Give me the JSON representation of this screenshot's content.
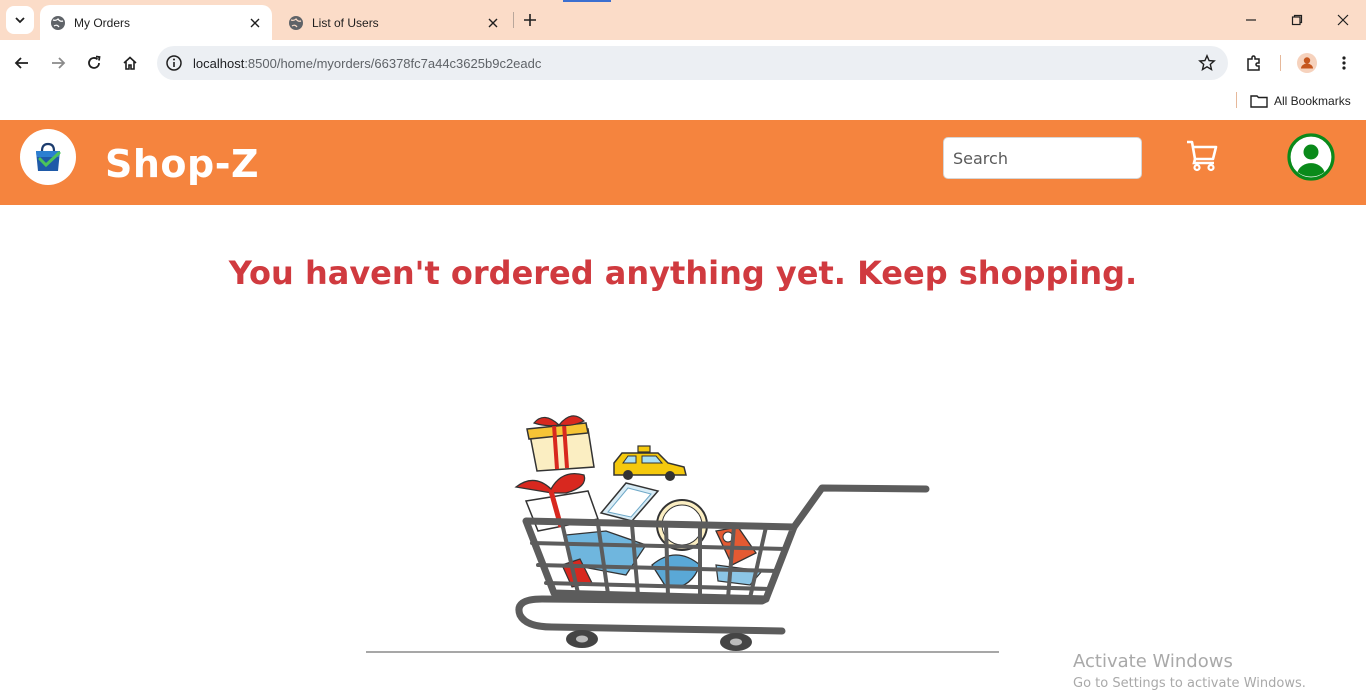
{
  "browser": {
    "tabs": [
      {
        "label": "My Orders",
        "active": true
      },
      {
        "label": "List of Users",
        "active": false
      }
    ],
    "url_host": "localhost",
    "url_path": ":8500/home/myorders/66378fc7a44c3625b9c2eadc",
    "bookmarks_label": "All Bookmarks"
  },
  "app": {
    "brand": "Shop-Z",
    "search_placeholder": "Search",
    "accent_color": "#f5843e",
    "profile_color": "#0a8a1a",
    "empty_message": "You haven't ordered anything yet. Keep shopping."
  },
  "watermark": {
    "line1": "Activate Windows",
    "line2": "Go to Settings to activate Windows."
  }
}
